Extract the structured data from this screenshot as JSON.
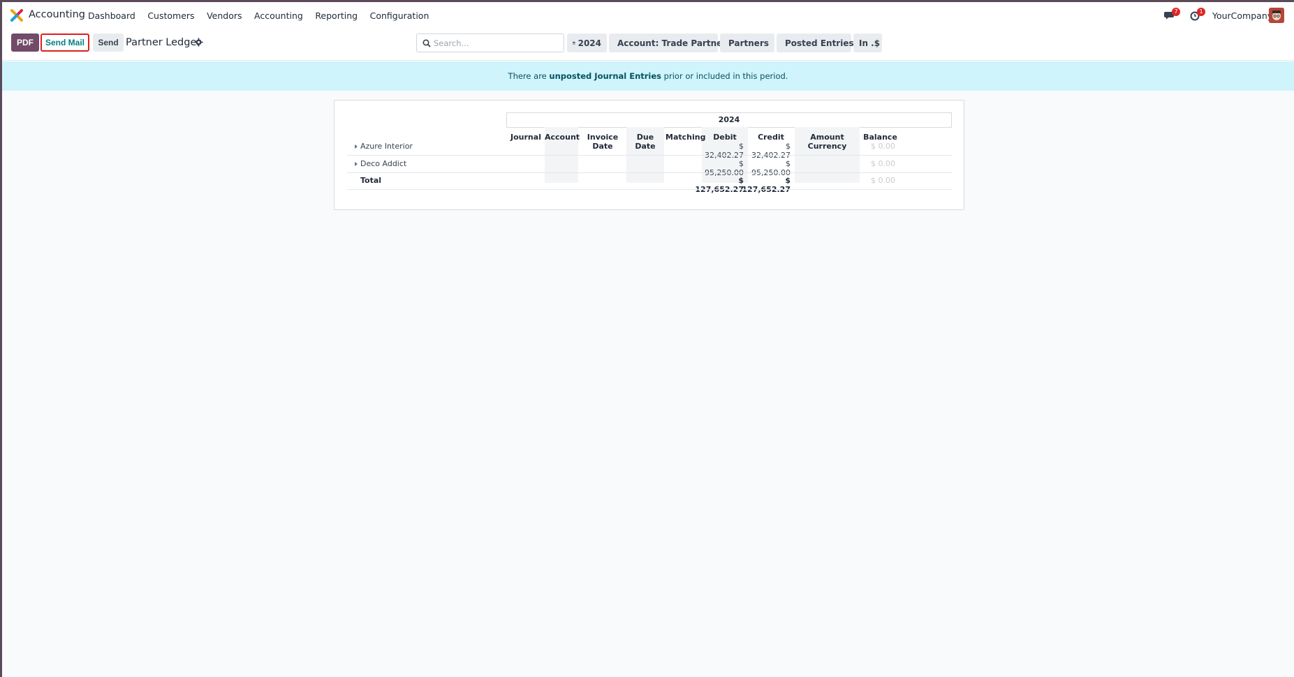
{
  "navbar": {
    "app_name": "Accounting",
    "menu": [
      "Dashboard",
      "Customers",
      "Vendors",
      "Accounting",
      "Reporting",
      "Configuration"
    ],
    "messages_badge": "7",
    "activities_badge": "1",
    "company": "YourCompany"
  },
  "control": {
    "pdf_label": "PDF",
    "send_mail_label": "Send Mail",
    "send_label": "Send",
    "report_title": "Partner Ledger",
    "search_placeholder": "Search...",
    "filters": {
      "date": "2024",
      "account": "Account: Trade Partners",
      "partners": "Partners",
      "posted": "Posted Entries",
      "currency": "In .$"
    }
  },
  "alert": {
    "prefix": "There are ",
    "link": "unposted Journal Entries",
    "suffix": " prior or included in this period."
  },
  "report": {
    "period": "2024",
    "columns": [
      "Journal",
      "Account",
      "Invoice Date",
      "Due Date",
      "Matching",
      "Debit",
      "Credit",
      "Amount Currency",
      "Balance"
    ],
    "rows": [
      {
        "name": "Azure Interior",
        "debit": "$ 32,402.27",
        "credit": "$ 32,402.27",
        "balance": "$ 0.00"
      },
      {
        "name": "Deco Addict",
        "debit": "$ 95,250.00",
        "credit": "$ 95,250.00",
        "balance": "$ 0.00"
      }
    ],
    "total": {
      "label": "Total",
      "debit": "$ 127,652.27",
      "credit": "$ 127,652.27",
      "balance": "$ 0.00"
    }
  },
  "colors": {
    "primary": "#714b67",
    "accent": "#017e84",
    "alert_bg": "#cff4fc",
    "highlight_border": "#e11d1d"
  }
}
